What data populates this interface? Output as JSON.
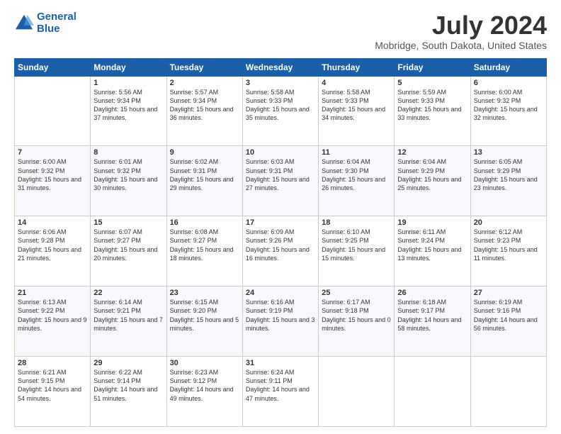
{
  "header": {
    "logo_line1": "General",
    "logo_line2": "Blue",
    "title": "July 2024",
    "subtitle": "Mobridge, South Dakota, United States"
  },
  "weekdays": [
    "Sunday",
    "Monday",
    "Tuesday",
    "Wednesday",
    "Thursday",
    "Friday",
    "Saturday"
  ],
  "weeks": [
    [
      {
        "day": "",
        "info": ""
      },
      {
        "day": "1",
        "info": "Sunrise: 5:56 AM\nSunset: 9:34 PM\nDaylight: 15 hours\nand 37 minutes."
      },
      {
        "day": "2",
        "info": "Sunrise: 5:57 AM\nSunset: 9:34 PM\nDaylight: 15 hours\nand 36 minutes."
      },
      {
        "day": "3",
        "info": "Sunrise: 5:58 AM\nSunset: 9:33 PM\nDaylight: 15 hours\nand 35 minutes."
      },
      {
        "day": "4",
        "info": "Sunrise: 5:58 AM\nSunset: 9:33 PM\nDaylight: 15 hours\nand 34 minutes."
      },
      {
        "day": "5",
        "info": "Sunrise: 5:59 AM\nSunset: 9:33 PM\nDaylight: 15 hours\nand 33 minutes."
      },
      {
        "day": "6",
        "info": "Sunrise: 6:00 AM\nSunset: 9:32 PM\nDaylight: 15 hours\nand 32 minutes."
      }
    ],
    [
      {
        "day": "7",
        "info": ""
      },
      {
        "day": "8",
        "info": "Sunrise: 6:01 AM\nSunset: 9:32 PM\nDaylight: 15 hours\nand 30 minutes."
      },
      {
        "day": "9",
        "info": "Sunrise: 6:02 AM\nSunset: 9:31 PM\nDaylight: 15 hours\nand 29 minutes."
      },
      {
        "day": "10",
        "info": "Sunrise: 6:03 AM\nSunset: 9:31 PM\nDaylight: 15 hours\nand 27 minutes."
      },
      {
        "day": "11",
        "info": "Sunrise: 6:04 AM\nSunset: 9:30 PM\nDaylight: 15 hours\nand 26 minutes."
      },
      {
        "day": "12",
        "info": "Sunrise: 6:04 AM\nSunset: 9:29 PM\nDaylight: 15 hours\nand 25 minutes."
      },
      {
        "day": "13",
        "info": "Sunrise: 6:05 AM\nSunset: 9:29 PM\nDaylight: 15 hours\nand 23 minutes."
      }
    ],
    [
      {
        "day": "14",
        "info": ""
      },
      {
        "day": "15",
        "info": "Sunrise: 6:07 AM\nSunset: 9:27 PM\nDaylight: 15 hours\nand 20 minutes."
      },
      {
        "day": "16",
        "info": "Sunrise: 6:08 AM\nSunset: 9:27 PM\nDaylight: 15 hours\nand 18 minutes."
      },
      {
        "day": "17",
        "info": "Sunrise: 6:09 AM\nSunset: 9:26 PM\nDaylight: 15 hours\nand 16 minutes."
      },
      {
        "day": "18",
        "info": "Sunrise: 6:10 AM\nSunset: 9:25 PM\nDaylight: 15 hours\nand 15 minutes."
      },
      {
        "day": "19",
        "info": "Sunrise: 6:11 AM\nSunset: 9:24 PM\nDaylight: 15 hours\nand 13 minutes."
      },
      {
        "day": "20",
        "info": "Sunrise: 6:12 AM\nSunset: 9:23 PM\nDaylight: 15 hours\nand 11 minutes."
      }
    ],
    [
      {
        "day": "21",
        "info": ""
      },
      {
        "day": "22",
        "info": "Sunrise: 6:14 AM\nSunset: 9:21 PM\nDaylight: 15 hours\nand 7 minutes."
      },
      {
        "day": "23",
        "info": "Sunrise: 6:15 AM\nSunset: 9:20 PM\nDaylight: 15 hours\nand 5 minutes."
      },
      {
        "day": "24",
        "info": "Sunrise: 6:16 AM\nSunset: 9:19 PM\nDaylight: 15 hours\nand 3 minutes."
      },
      {
        "day": "25",
        "info": "Sunrise: 6:17 AM\nSunset: 9:18 PM\nDaylight: 15 hours\nand 0 minutes."
      },
      {
        "day": "26",
        "info": "Sunrise: 6:18 AM\nSunset: 9:17 PM\nDaylight: 14 hours\nand 58 minutes."
      },
      {
        "day": "27",
        "info": "Sunrise: 6:19 AM\nSunset: 9:16 PM\nDaylight: 14 hours\nand 56 minutes."
      }
    ],
    [
      {
        "day": "28",
        "info": "Sunrise: 6:21 AM\nSunset: 9:15 PM\nDaylight: 14 hours\nand 54 minutes."
      },
      {
        "day": "29",
        "info": "Sunrise: 6:22 AM\nSunset: 9:14 PM\nDaylight: 14 hours\nand 51 minutes."
      },
      {
        "day": "30",
        "info": "Sunrise: 6:23 AM\nSunset: 9:12 PM\nDaylight: 14 hours\nand 49 minutes."
      },
      {
        "day": "31",
        "info": "Sunrise: 6:24 AM\nSunset: 9:11 PM\nDaylight: 14 hours\nand 47 minutes."
      },
      {
        "day": "",
        "info": ""
      },
      {
        "day": "",
        "info": ""
      },
      {
        "day": "",
        "info": ""
      }
    ]
  ],
  "week1_sun_info": "Sunrise: 6:00 AM\nSunset: 9:32 PM\nDaylight: 15 hours\nand 31 minutes.",
  "week2_sun_info": "Sunrise: 6:00 AM\nSunset: 9:32 PM\nDaylight: 15 hours\nand 31 minutes.",
  "week3_sun_info": "Sunrise: 6:06 AM\nSunset: 9:28 PM\nDaylight: 15 hours\nand 21 minutes.",
  "week4_sun_info": "Sunrise: 6:13 AM\nSunset: 9:22 PM\nDaylight: 15 hours\nand 9 minutes."
}
